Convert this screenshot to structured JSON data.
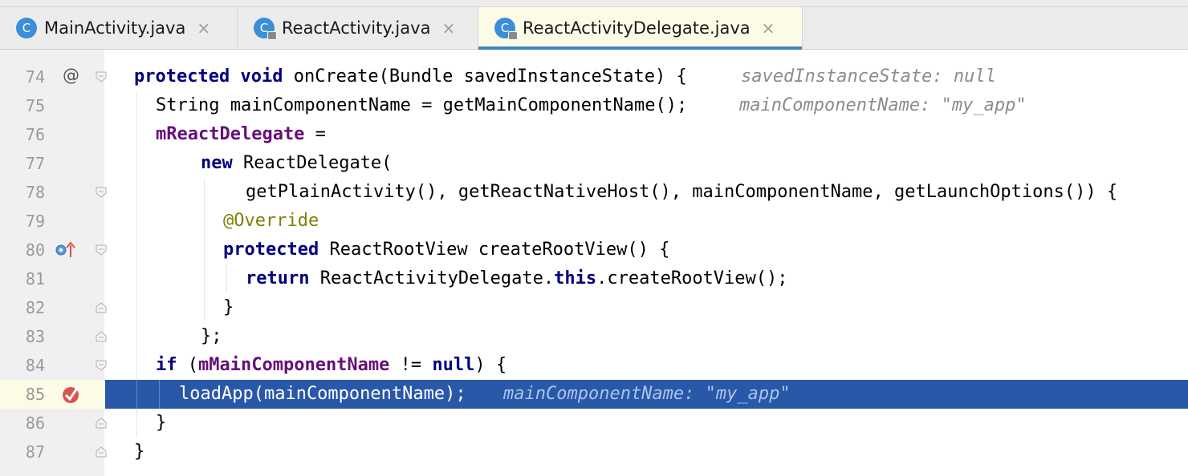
{
  "tabs": [
    {
      "label": "MainActivity.java",
      "icon": "c-class-icon",
      "letter": "C"
    },
    {
      "label": "ReactActivity.java",
      "icon": "c-class-locked-icon",
      "letter": "C"
    },
    {
      "label": "ReactActivityDelegate.java",
      "icon": "c-class-locked-icon",
      "letter": "C",
      "active": true
    }
  ],
  "close_glyph": "×",
  "gutter_marks": {
    "override_at": "@"
  },
  "lines": [
    {
      "num": "74",
      "code": [
        "protected",
        " ",
        "void",
        " onCreate(Bundle savedInstanceState) {"
      ],
      "hint": "savedInstanceState: null"
    },
    {
      "num": "75",
      "code": "String mainComponentName = getMainComponentName();",
      "hint": "mainComponentName: \"my_app\""
    },
    {
      "num": "76",
      "field": "mReactDelegate",
      "code": " ="
    },
    {
      "num": "77",
      "kw": "new",
      "code": " ReactDelegate("
    },
    {
      "num": "78",
      "code": "getPlainActivity(), getReactNativeHost(), mainComponentName, getLaunchOptions()) {"
    },
    {
      "num": "79",
      "ann": "@Override"
    },
    {
      "num": "80",
      "kw": "protected",
      "code": " ReactRootView createRootView() {"
    },
    {
      "num": "81",
      "kw": "return",
      "code": " ReactActivityDelegate.",
      "kw2": "this",
      "code2": ".createRootView();"
    },
    {
      "num": "82",
      "code": "}"
    },
    {
      "num": "83",
      "code": "};"
    },
    {
      "num": "84",
      "kw": "if",
      "code": " (",
      "field": "mMainComponentName",
      "code2": " != ",
      "kw2": "null",
      "code3": ") {"
    },
    {
      "num": "85",
      "code": "loadApp(mainComponentName);",
      "hint": "mainComponentName: \"my_app\""
    },
    {
      "num": "86",
      "code": "}"
    },
    {
      "num": "87",
      "code": "}"
    }
  ],
  "colors": {
    "keyword": "#000080",
    "field": "#660e7a",
    "annotation": "#808000",
    "hint": "#8c8c8c",
    "execution_line": "#2a58a8",
    "breakpoint": "#d9534f",
    "active_tab_underline": "#4083c9"
  }
}
